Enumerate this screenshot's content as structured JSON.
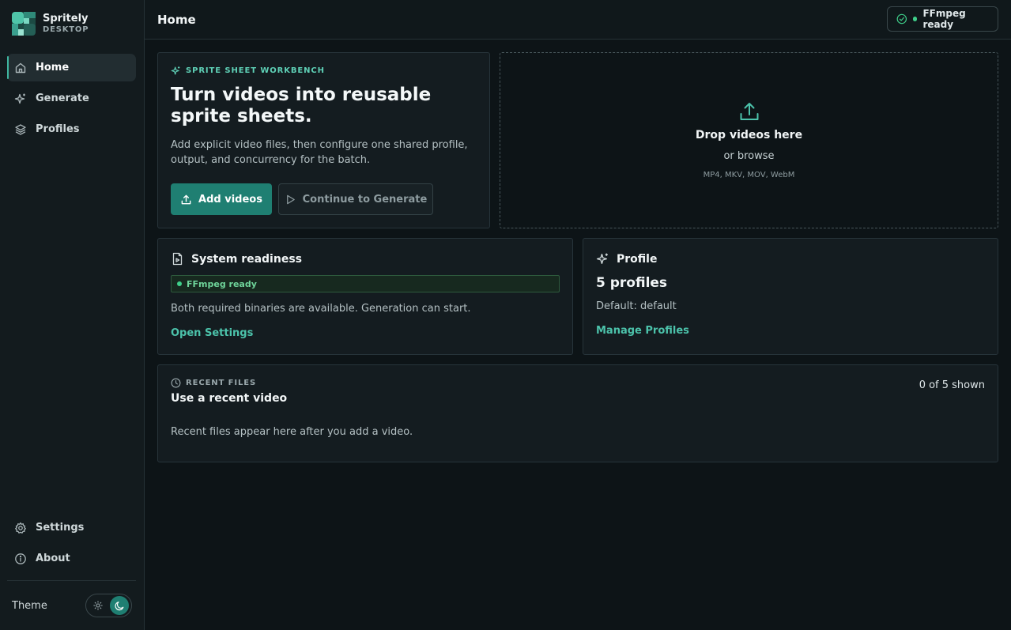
{
  "app": {
    "name": "Spritely",
    "subtitle": "DESKTOP"
  },
  "sidebar": {
    "items": [
      {
        "label": "Home",
        "icon": "home-icon",
        "active": true
      },
      {
        "label": "Generate",
        "icon": "sparkles-icon"
      },
      {
        "label": "Profiles",
        "icon": "layers-icon"
      }
    ],
    "bottom_items": [
      {
        "label": "Settings",
        "icon": "gear-icon"
      },
      {
        "label": "About",
        "icon": "info-icon"
      }
    ],
    "theme_label": "Theme",
    "theme_selected": "dark"
  },
  "header": {
    "title": "Home",
    "status": "FFmpeg ready"
  },
  "hero": {
    "eyebrow": "SPRITE SHEET WORKBENCH",
    "title": "Turn videos into reusable sprite sheets.",
    "description": "Add explicit video files, then configure one shared profile, output, and concurrency for the batch.",
    "primary_button": "Add videos",
    "secondary_button": "Continue to Generate"
  },
  "dropzone": {
    "title": "Drop videos here",
    "browse": "or browse",
    "formats": "MP4, MKV, MOV, WebM"
  },
  "readiness": {
    "title": "System readiness",
    "badge": "FFmpeg ready",
    "text": "Both required binaries are available. Generation can start.",
    "link": "Open Settings"
  },
  "profile": {
    "title": "Profile",
    "count": "5 profiles",
    "default": "Default: default",
    "link": "Manage Profiles"
  },
  "recent": {
    "eyebrow": "RECENT FILES",
    "title": "Use a recent video",
    "count": "0 of 5 shown",
    "empty": "Recent files appear here after you add a video."
  },
  "colors": {
    "accent": "#1f7f72",
    "accent_text": "#4cc3ab",
    "success": "#3fcf8a",
    "background": "#0d1417"
  }
}
